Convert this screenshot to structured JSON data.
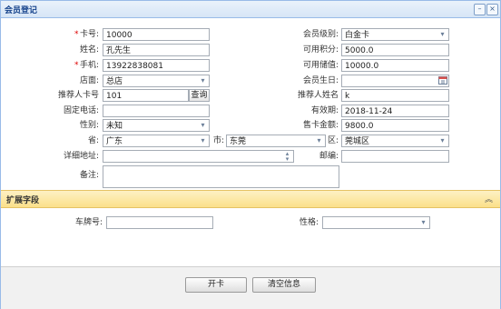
{
  "window": {
    "title": "会员登记"
  },
  "form": {
    "card_no": {
      "label": "卡号:",
      "value": "10000"
    },
    "name": {
      "label": "姓名:",
      "value": "孔先生"
    },
    "phone": {
      "label": "手机:",
      "value": "13922838081"
    },
    "store": {
      "label": "店面:",
      "value": "总店"
    },
    "referrer_card": {
      "label": "推荐人卡号",
      "value": "101",
      "button": "查询"
    },
    "fixed_phone": {
      "label": "固定电话:",
      "value": ""
    },
    "gender": {
      "label": "性别:",
      "value": "未知"
    },
    "province": {
      "label": "省:",
      "value": "广东"
    },
    "city": {
      "label": "市:",
      "value": "东莞"
    },
    "district": {
      "label": "区:",
      "value": "莞城区"
    },
    "address": {
      "label": "详细地址:",
      "value": ""
    },
    "remark": {
      "label": "备注:",
      "value": ""
    },
    "member_level": {
      "label": "会员级别:",
      "value": "白金卡"
    },
    "points": {
      "label": "可用积分:",
      "value": "5000.0"
    },
    "balance": {
      "label": "可用储值:",
      "value": "10000.0"
    },
    "birthday": {
      "label": "会员生日:",
      "value": ""
    },
    "referrer_name": {
      "label": "推荐人姓名",
      "value": "k"
    },
    "valid_until": {
      "label": "有效期:",
      "value": "2018-11-24"
    },
    "card_amount": {
      "label": "售卡金额:",
      "value": "9800.0"
    },
    "postcode": {
      "label": "邮编:",
      "value": ""
    }
  },
  "extended": {
    "title": "扩展字段",
    "plate": {
      "label": "车牌号:",
      "value": ""
    },
    "personality": {
      "label": "性格:",
      "value": ""
    }
  },
  "buttons": {
    "open_card": "开卡",
    "clear": "清空信息"
  },
  "icons": {
    "minimize": "minimize-icon",
    "close": "close-icon",
    "dropdown": "chevron-down-icon",
    "calendar": "calendar-icon",
    "collapse": "double-chevron-up-icon"
  }
}
